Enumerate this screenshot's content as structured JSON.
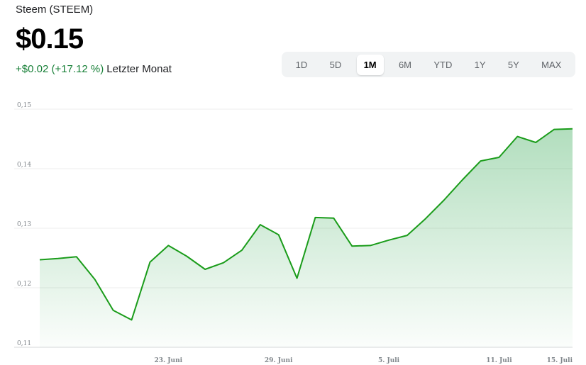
{
  "header": {
    "title": "Steem (STEEM)",
    "price": "$0.15",
    "change": "+$0.02 (+17.12 %)",
    "period": "Letzter Monat"
  },
  "ranges": [
    {
      "label": "1D",
      "active": false
    },
    {
      "label": "5D",
      "active": false
    },
    {
      "label": "1M",
      "active": true
    },
    {
      "label": "6M",
      "active": false
    },
    {
      "label": "YTD",
      "active": false
    },
    {
      "label": "1Y",
      "active": false
    },
    {
      "label": "5Y",
      "active": false
    },
    {
      "label": "MAX",
      "active": false
    }
  ],
  "colors": {
    "line": "#1a9c1a",
    "fill": "#34a853",
    "positive": "#188038"
  },
  "chart_data": {
    "type": "area",
    "x": [
      "2024-06-16",
      "2024-06-17",
      "2024-06-18",
      "2024-06-19",
      "2024-06-20",
      "2024-06-21",
      "2024-06-22",
      "2024-06-23",
      "2024-06-24",
      "2024-06-25",
      "2024-06-26",
      "2024-06-27",
      "2024-06-28",
      "2024-06-29",
      "2024-06-30",
      "2024-07-01",
      "2024-07-02",
      "2024-07-03",
      "2024-07-04",
      "2024-07-05",
      "2024-07-06",
      "2024-07-07",
      "2024-07-08",
      "2024-07-09",
      "2024-07-10",
      "2024-07-11",
      "2024-07-12",
      "2024-07-13",
      "2024-07-14",
      "2024-07-15"
    ],
    "series": [
      {
        "values": [
          0.1247,
          0.1249,
          0.1252,
          0.1214,
          0.1162,
          0.1146,
          0.1243,
          0.1271,
          0.1253,
          0.1231,
          0.1242,
          0.1263,
          0.1306,
          0.1289,
          0.1216,
          0.1318,
          0.1317,
          0.127,
          0.1271,
          0.128,
          0.1288,
          0.1316,
          0.1347,
          0.1381,
          0.1413,
          0.1419,
          0.1454,
          0.1444,
          0.1466,
          0.1467
        ]
      }
    ],
    "ylim": [
      0.11,
      0.15
    ],
    "yticks": [
      {
        "v": 0.11,
        "label": "0,11"
      },
      {
        "v": 0.12,
        "label": "0,12"
      },
      {
        "v": 0.13,
        "label": "0,13"
      },
      {
        "v": 0.14,
        "label": "0,14"
      },
      {
        "v": 0.15,
        "label": "0,15"
      }
    ],
    "xticks": [
      {
        "i": 7,
        "label": "23. Juni"
      },
      {
        "i": 13,
        "label": "29. Juni"
      },
      {
        "i": 19,
        "label": "5. Juli"
      },
      {
        "i": 25,
        "label": "11. Juli"
      },
      {
        "i": 29,
        "label": "15. Juli"
      }
    ],
    "grid": true
  }
}
